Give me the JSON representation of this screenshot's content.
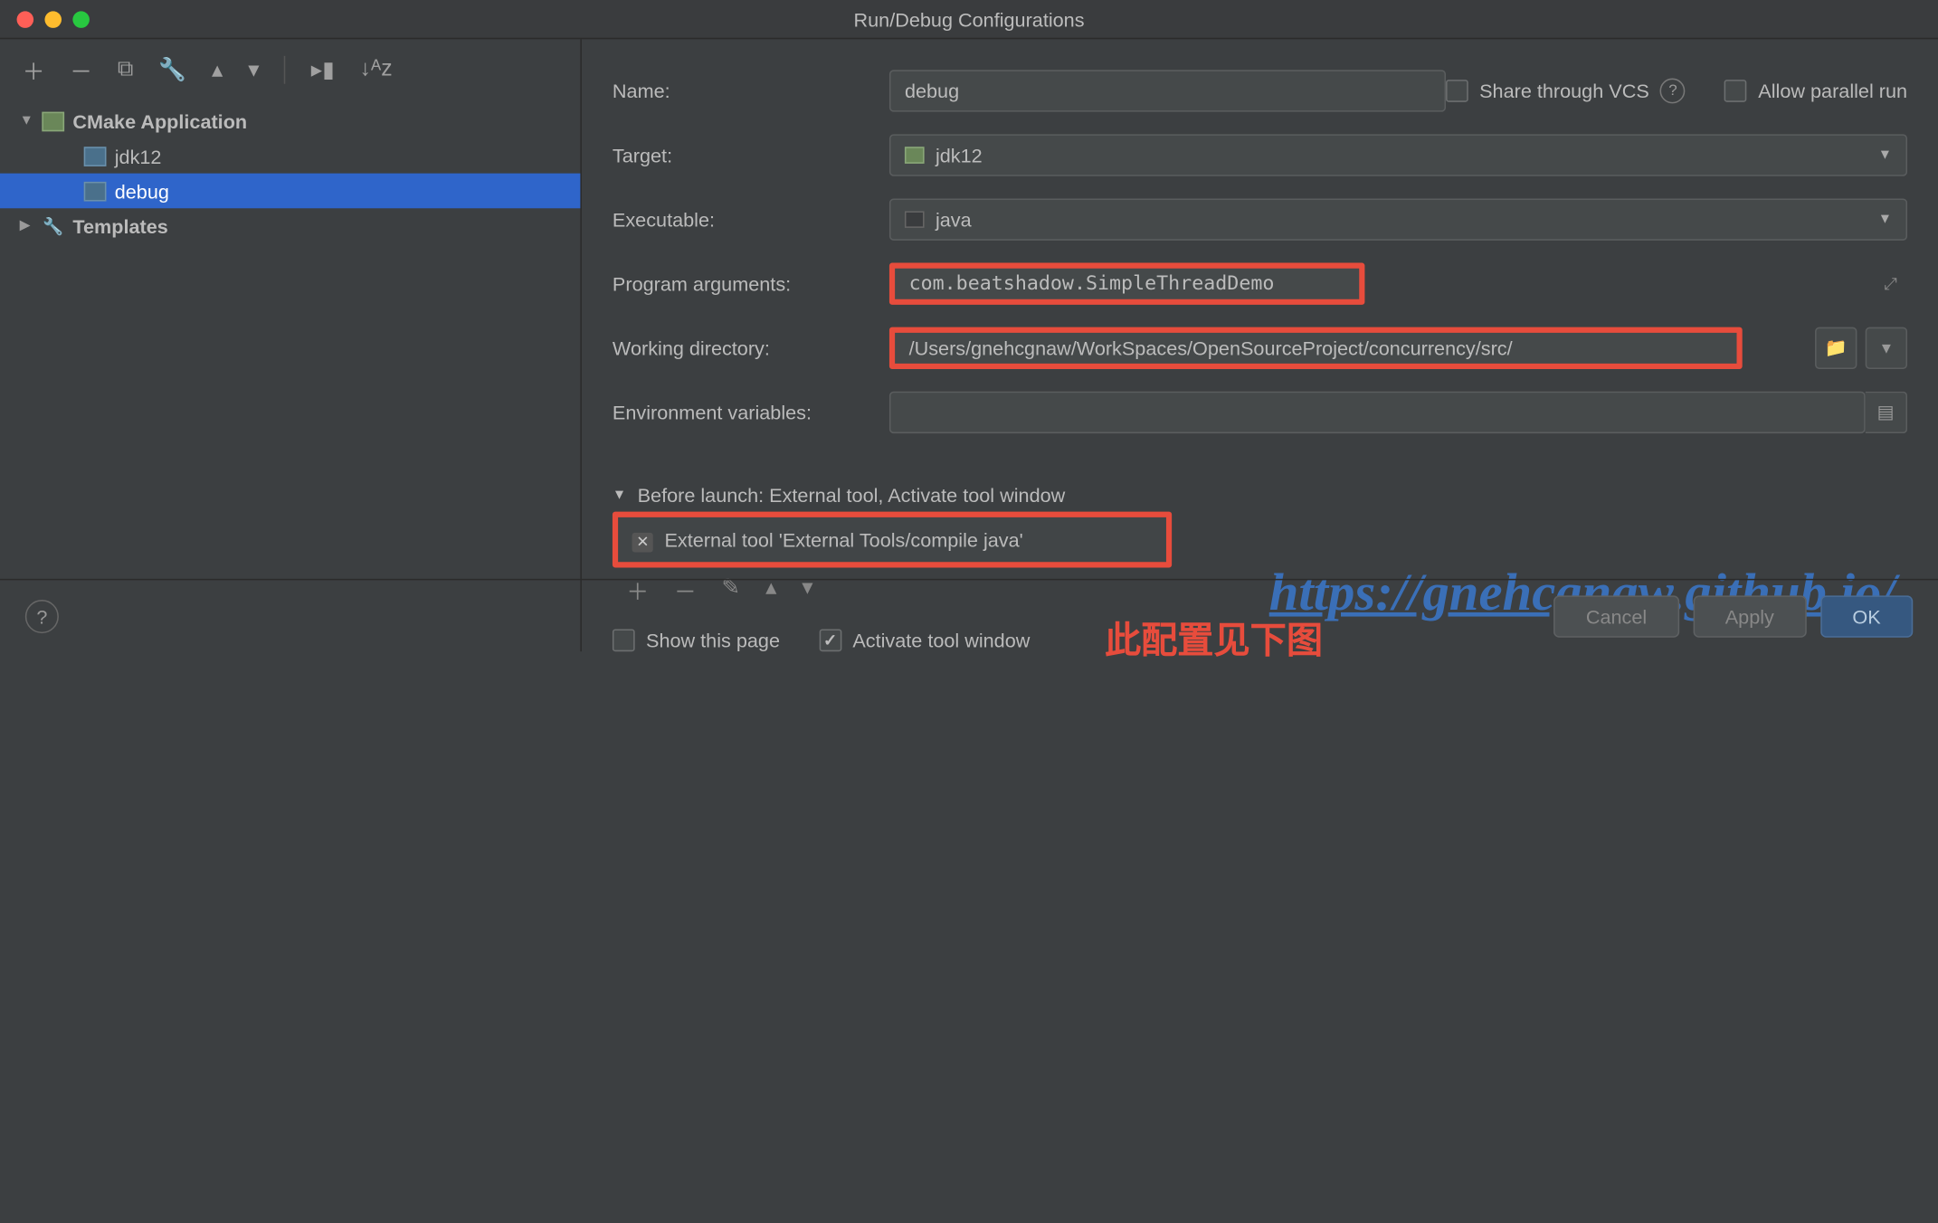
{
  "window": {
    "title": "Run/Debug Configurations"
  },
  "tree": {
    "root": {
      "label": "CMake Application"
    },
    "items": [
      {
        "label": "jdk12"
      },
      {
        "label": "debug"
      }
    ],
    "templates": "Templates"
  },
  "form": {
    "name_label": "Name:",
    "name_value": "debug",
    "share_vcs": "Share through VCS",
    "allow_parallel": "Allow parallel run",
    "target_label": "Target:",
    "target_value": "jdk12",
    "executable_label": "Executable:",
    "executable_value": "java",
    "progargs_label": "Program arguments:",
    "progargs_value": "com.beatshadow.SimpleThreadDemo",
    "workdir_label": "Working directory:",
    "workdir_value": "/Users/gnehcgnaw/WorkSpaces/OpenSourceProject/concurrency/src/",
    "envvars_label": "Environment variables:"
  },
  "before_launch": {
    "header": "Before launch: External tool, Activate tool window",
    "task": "External tool 'External Tools/compile java'",
    "show_page": "Show this page",
    "activate_window": "Activate tool window"
  },
  "annotation": {
    "text": "此配置见下图"
  },
  "watermark": {
    "text": "https://gnehcgnaw.github.io/"
  },
  "footer": {
    "cancel": "Cancel",
    "apply": "Apply",
    "ok": "OK"
  }
}
